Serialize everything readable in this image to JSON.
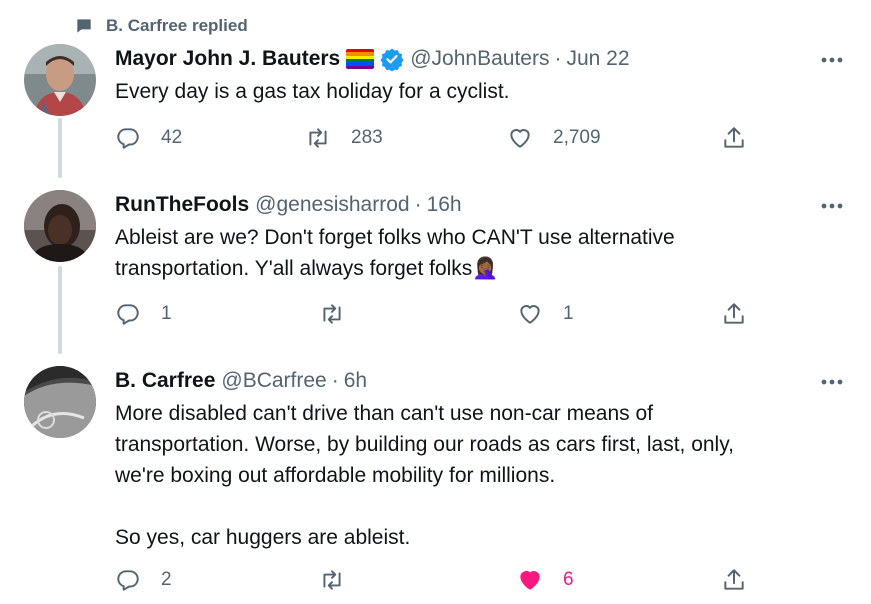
{
  "social_context": {
    "text": "B. Carfree replied"
  },
  "tweets": [
    {
      "name": "Mayor John J. Bauters",
      "handle": "@JohnBauters",
      "separator": "·",
      "time": "Jun 22",
      "text": "Every day is a gas tax holiday for a cyclist.",
      "replies": "42",
      "retweets": "283",
      "likes": "2,709",
      "liked": false
    },
    {
      "name": "RunTheFools",
      "handle": "@genesisharrod",
      "separator": "·",
      "time": "16h",
      "text": "Ableist are we? Don't forget folks who CAN'T use alternative\ntransportation. Y'all always forget folks",
      "emoji": "🤦🏾‍♀️",
      "replies": "1",
      "retweets": "",
      "likes": "1",
      "liked": false
    },
    {
      "name": "B. Carfree",
      "handle": "@BCarfree",
      "separator": "·",
      "time": "6h",
      "text": "More disabled can't drive than can't use non-car means of\ntransportation. Worse, by building our roads as cars first, last, only,\nwe're boxing out affordable mobility for millions.\n\nSo yes, car huggers are ableist.",
      "replies": "2",
      "retweets": "",
      "likes": "6",
      "liked": true
    }
  ],
  "colors": {
    "secondary_text": "#536471",
    "verified_blue": "#1d9bf0",
    "like_pink": "#f91880",
    "thread_line": "#cfd9de"
  },
  "icons": [
    "reply-icon",
    "retweet-icon",
    "like-icon",
    "share-icon",
    "more-icon",
    "verified-badge-icon",
    "rainbow-flag-icon"
  ]
}
